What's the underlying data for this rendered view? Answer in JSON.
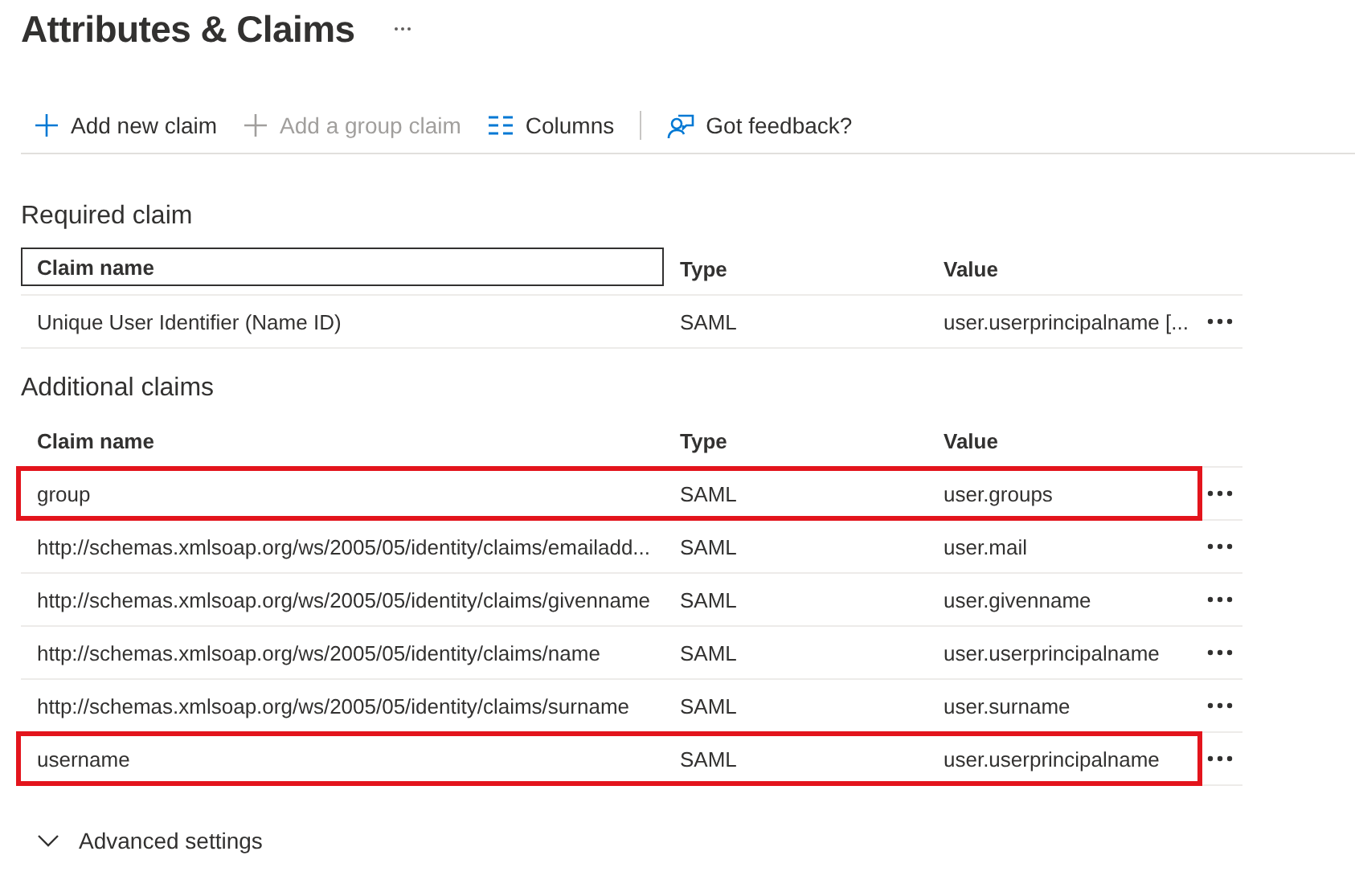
{
  "page": {
    "title": "Attributes & Claims"
  },
  "toolbar": [
    {
      "kind": "add",
      "label": "Add new claim",
      "disabled": false
    },
    {
      "kind": "add",
      "label": "Add a group claim",
      "disabled": true
    },
    {
      "kind": "columns",
      "label": "Columns",
      "disabled": false
    },
    {
      "kind": "feedback",
      "label": "Got feedback?",
      "disabled": false
    }
  ],
  "sections": [
    {
      "title": "Required claim",
      "columns": [
        {
          "label": "Claim name",
          "focused": true
        },
        {
          "label": "Type",
          "focused": false
        },
        {
          "label": "Value",
          "focused": false
        }
      ],
      "rows": [
        {
          "claim_name": "Unique User Identifier (Name ID)",
          "type": "SAML",
          "value": "user.userprincipalname [...",
          "highlighted": false
        }
      ]
    },
    {
      "title": "Additional claims",
      "columns": [
        {
          "label": "Claim name",
          "focused": false
        },
        {
          "label": "Type",
          "focused": false
        },
        {
          "label": "Value",
          "focused": false
        }
      ],
      "rows": [
        {
          "claim_name": "group",
          "type": "SAML",
          "value": "user.groups",
          "highlighted": true
        },
        {
          "claim_name": "http://schemas.xmlsoap.org/ws/2005/05/identity/claims/emailadd...",
          "type": "SAML",
          "value": "user.mail",
          "highlighted": false
        },
        {
          "claim_name": "http://schemas.xmlsoap.org/ws/2005/05/identity/claims/givenname",
          "type": "SAML",
          "value": "user.givenname",
          "highlighted": false
        },
        {
          "claim_name": "http://schemas.xmlsoap.org/ws/2005/05/identity/claims/name",
          "type": "SAML",
          "value": "user.userprincipalname",
          "highlighted": false
        },
        {
          "claim_name": "http://schemas.xmlsoap.org/ws/2005/05/identity/claims/surname",
          "type": "SAML",
          "value": "user.surname",
          "highlighted": false
        },
        {
          "claim_name": "username",
          "type": "SAML",
          "value": "user.userprincipalname",
          "highlighted": true
        }
      ]
    }
  ],
  "advanced": {
    "label": "Advanced settings",
    "expanded": false
  }
}
